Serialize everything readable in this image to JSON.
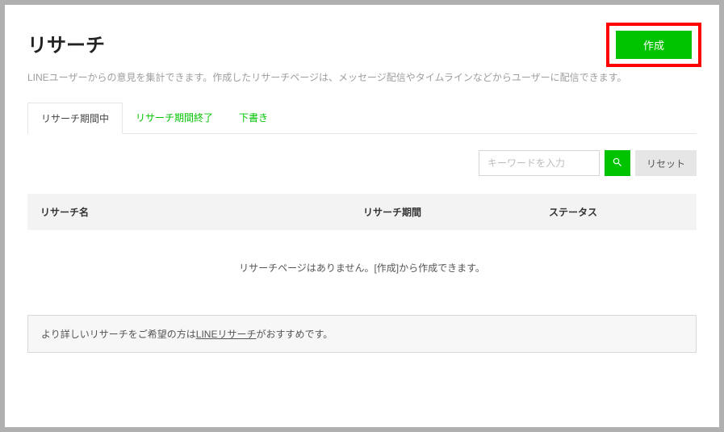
{
  "header": {
    "title": "リサーチ",
    "description": "LINEユーザーからの意見を集計できます。作成したリサーチページは、メッセージ配信やタイムラインなどからユーザーに配信できます。",
    "create_label": "作成"
  },
  "tabs": {
    "active": "リサーチ期間中",
    "ended": "リサーチ期間終了",
    "draft": "下書き"
  },
  "search": {
    "placeholder": "キーワードを入力",
    "reset_label": "リセット"
  },
  "table": {
    "columns": {
      "name": "リサーチ名",
      "period": "リサーチ期間",
      "status": "ステータス"
    },
    "empty_message": "リサーチページはありません。[作成]から作成できます。"
  },
  "info": {
    "prefix": "より詳しいリサーチをご希望の方は",
    "link": "LINEリサーチ",
    "suffix": "がおすすめです。"
  }
}
